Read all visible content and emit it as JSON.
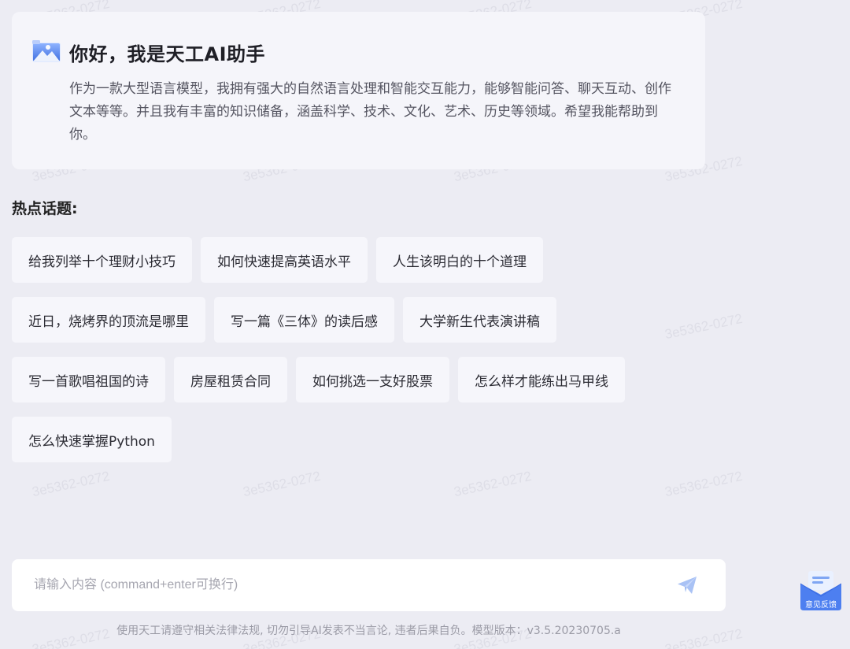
{
  "watermark": {
    "text": "3e5362-0272"
  },
  "welcome": {
    "title": "你好，我是天工AI助手",
    "description": "作为一款大型语言模型，我拥有强大的自然语言处理和智能交互能力，能够智能问答、聊天互动、创作文本等等。并且我有丰富的知识储备，涵盖科学、技术、文化、艺术、历史等领域。希望我能帮助到你。",
    "logo_icon": "mountain-logo-icon"
  },
  "hot_topics": {
    "label": "热点话题:",
    "items": [
      "给我列举十个理财小技巧",
      "如何快速提高英语水平",
      "人生该明白的十个道理",
      "近日，烧烤界的顶流是哪里",
      "写一篇《三体》的读后感",
      "大学新生代表演讲稿",
      "写一首歌唱祖国的诗",
      "房屋租赁合同",
      "如何挑选一支好股票",
      "怎么样才能练出马甲线",
      "怎么快速掌握Python"
    ]
  },
  "input": {
    "placeholder": "请输入内容 (command+enter可换行)",
    "value": "",
    "send_icon": "send-icon"
  },
  "footer": {
    "note": "使用天工请遵守相关法律法规, 切勿引导AI发表不当言论, 违者后果自负。模型版本：v3.5.20230705.a"
  },
  "feedback": {
    "label": "意见反馈",
    "icon": "envelope-icon"
  },
  "colors": {
    "background": "#ececf3",
    "card": "#f5f5fa",
    "accent": "#5b8df5",
    "send_icon": "#a9c2f5"
  }
}
